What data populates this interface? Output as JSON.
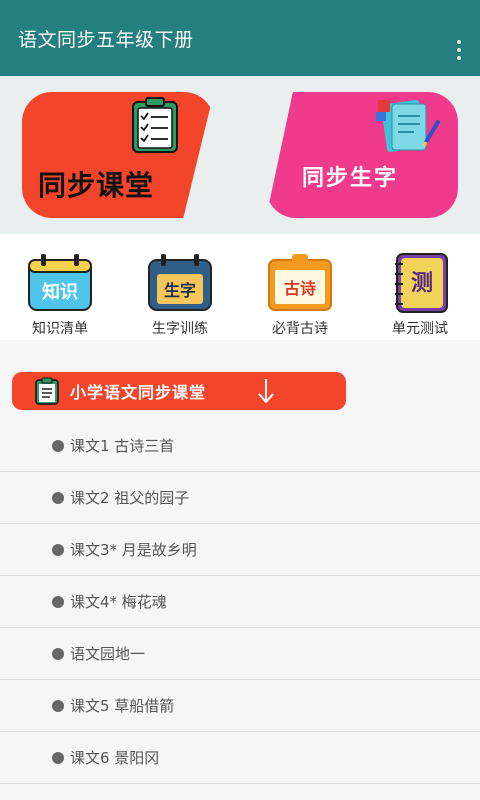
{
  "appbar": {
    "title": "语文同步五年级下册"
  },
  "banner": {
    "left_label": "同步课堂",
    "right_label": "同步生字"
  },
  "quick_links": [
    {
      "icon_text": "知识",
      "label": "知识清单"
    },
    {
      "icon_text": "生字",
      "label": "生字训练"
    },
    {
      "icon_text": "古诗",
      "label": "必背古诗"
    },
    {
      "icon_text": "测",
      "label": "单元测试"
    }
  ],
  "section": {
    "title": "小学语文同步课堂"
  },
  "lessons": [
    "课文1 古诗三首",
    "课文2 祖父的园子",
    "课文3* 月是故乡明",
    "课文4* 梅花魂",
    "语文园地一",
    "课文5 草船借箭",
    "课文6 景阳冈"
  ],
  "colors": {
    "appbar": "#23807e",
    "red_card": "#f3452c",
    "pink_card": "#f03b8c",
    "section_header": "#f3452c"
  }
}
